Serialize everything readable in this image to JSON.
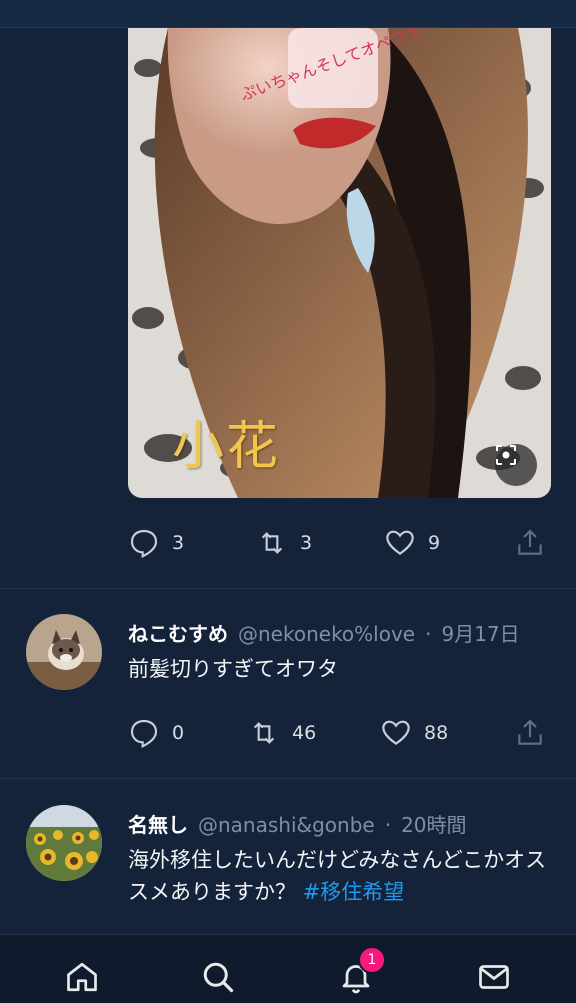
{
  "media": {
    "caption": "小花",
    "sticker_text": "ぷいちゃんそしてオペコで",
    "lens_icon": "lens-icon"
  },
  "post1": {
    "replies": "3",
    "retweets": "3",
    "likes": "9"
  },
  "tweets": [
    {
      "display_name": "ねこむすめ",
      "handle": "@nekoneko%love",
      "separator": "·",
      "time": "9月17日",
      "text": "前髪切りすぎてオワタ",
      "hashtag": "",
      "replies": "0",
      "retweets": "46",
      "likes": "88"
    },
    {
      "display_name": "名無し",
      "handle": "@nanashi&gonbe",
      "separator": "·",
      "time": "20時間",
      "text": "海外移住したいんだけどみなさんどこかオススメありますか？",
      "hashtag": "#移住希望"
    }
  ],
  "bottom_nav": {
    "items": [
      "home-icon",
      "search-icon",
      "notifications-icon",
      "messages-icon"
    ],
    "notification_count": "1"
  },
  "colors": {
    "background": "#15233a",
    "accent": "#1d9bf0",
    "badge": "#f91880",
    "caption": "#f1c64a"
  }
}
